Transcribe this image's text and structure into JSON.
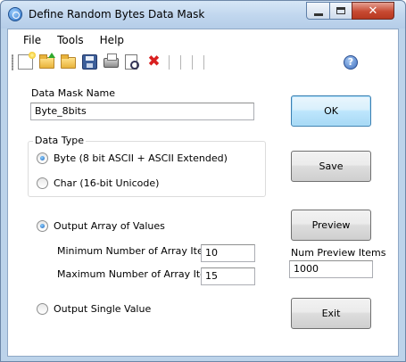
{
  "window": {
    "title": "Define Random Bytes Data Mask",
    "close_glyph": "✕"
  },
  "menu": {
    "items": [
      "File",
      "Tools",
      "Help"
    ]
  },
  "toolbar": {
    "icons": [
      "new-icon",
      "open-icon",
      "folder-icon",
      "save-icon",
      "print-icon",
      "print-preview-icon",
      "delete-icon",
      "help-icon"
    ],
    "delete_glyph": "✖",
    "help_glyph": "?"
  },
  "form": {
    "mask_name_label": "Data Mask Name",
    "mask_name_value": "Byte_8bits",
    "data_type": {
      "title": "Data Type",
      "options": [
        {
          "label": "Byte (8 bit ASCII + ASCII Extended)",
          "checked": true
        },
        {
          "label": "Char (16-bit Unicode)",
          "checked": false
        }
      ]
    },
    "output_array": {
      "label": "Output Array of Values",
      "checked": true,
      "min_label": "Minimum Number of Array Items:",
      "min_value": "10",
      "max_label": "Maximum Number of Array Items:",
      "max_value": "15"
    },
    "output_single": {
      "label": "Output Single Value",
      "checked": false
    }
  },
  "buttons": {
    "ok": "OK",
    "save": "Save",
    "preview": "Preview",
    "exit": "Exit"
  },
  "preview": {
    "label": "Num Preview Items",
    "value": "1000"
  }
}
